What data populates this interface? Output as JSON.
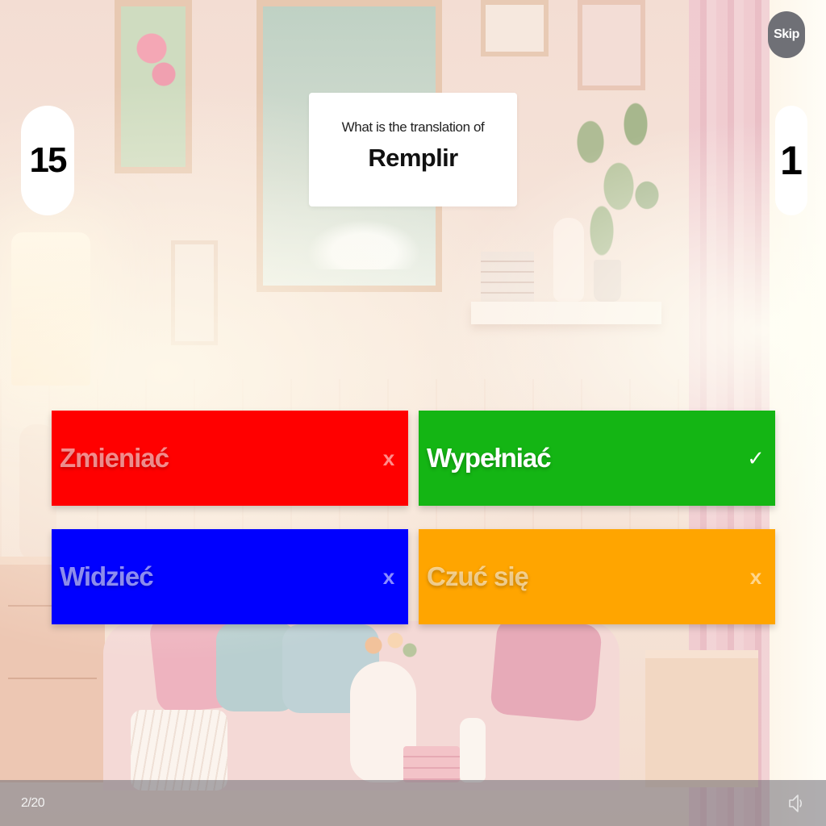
{
  "header": {
    "skip_label": "Skip",
    "timer_value": "15",
    "score_value": "1"
  },
  "question": {
    "prompt": "What is the translation of",
    "word": "Remplir"
  },
  "answers": [
    {
      "label": "Zmieniać",
      "mark": "x",
      "color": "#ff0000",
      "state": "incorrect"
    },
    {
      "label": "Wypełniać",
      "mark": "✓",
      "color": "#14b514",
      "state": "correct"
    },
    {
      "label": "Widzieć",
      "mark": "x",
      "color": "#0000ff",
      "state": "incorrect"
    },
    {
      "label": "Czuć się",
      "mark": "x",
      "color": "#ffa500",
      "state": "incorrect"
    }
  ],
  "footer": {
    "progress": "2/20",
    "sound_icon": "speaker-icon"
  },
  "theme": {
    "skip_bg": "#6f7076",
    "card_bg": "#ffffff",
    "bottom_bar_bg": "#6e6c74"
  }
}
